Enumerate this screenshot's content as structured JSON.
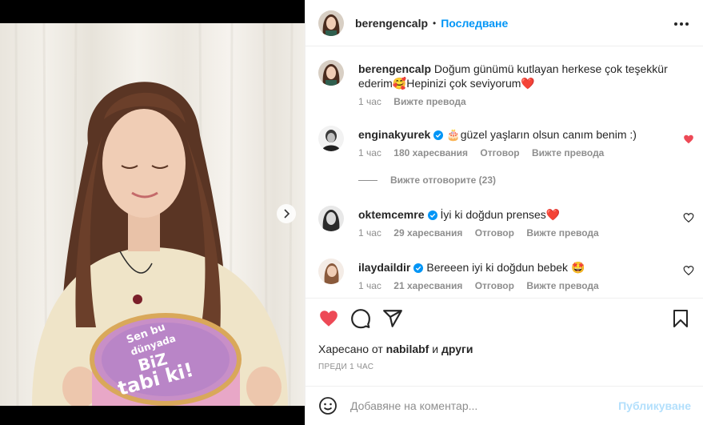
{
  "post": {
    "username": "berengencalp",
    "follow_label": "Последване",
    "separator": "•",
    "more_icon": "more-horizontal-icon"
  },
  "caption": {
    "username": "berengencalp",
    "text_part1": "Doğum günümü kutlayan herkese çok teşekkür ederim",
    "emoji1": "🥰",
    "text_part2": "Hepinizi çok seviyorum",
    "emoji2": "❤️",
    "time": "1 час",
    "translate": "Вижте превода"
  },
  "comments": [
    {
      "username": "enginakyurek",
      "verified": true,
      "emoji_prefix": "🎂",
      "text": "güzel yaşların olsun canım benim :)",
      "time": "1 час",
      "likes": "180 харесвания",
      "reply": "Отговор",
      "translate": "Вижте превода",
      "liked": true
    },
    {
      "username": "oktemcemre",
      "verified": true,
      "emoji_prefix": "",
      "text": "İyi ki doğdun prenses",
      "emoji_suffix": "❤️",
      "time": "1 час",
      "likes": "29 харесвания",
      "reply": "Отговор",
      "translate": "Вижте превода",
      "liked": false
    },
    {
      "username": "ilaydaildir",
      "verified": true,
      "emoji_prefix": "",
      "text": "Bereeen iyi ki doğdun bebek",
      "emoji_suffix": "🤩",
      "time": "1 час",
      "likes": "21 харесвания",
      "reply": "Отговор",
      "translate": "Вижте превода",
      "liked": false
    }
  ],
  "view_replies": "Вижте отговорите (23)",
  "likes_line": {
    "prefix": "Харесано от",
    "user": "nabilabf",
    "and": "и",
    "others": "други"
  },
  "timestamp": "ПРЕДИ 1 ЧАС",
  "composer": {
    "placeholder": "Добавяне на коментар...",
    "post_label": "Публикуване"
  },
  "colors": {
    "accent": "#0095f6",
    "like_red": "#ed4956",
    "muted": "#8e8e8e"
  }
}
